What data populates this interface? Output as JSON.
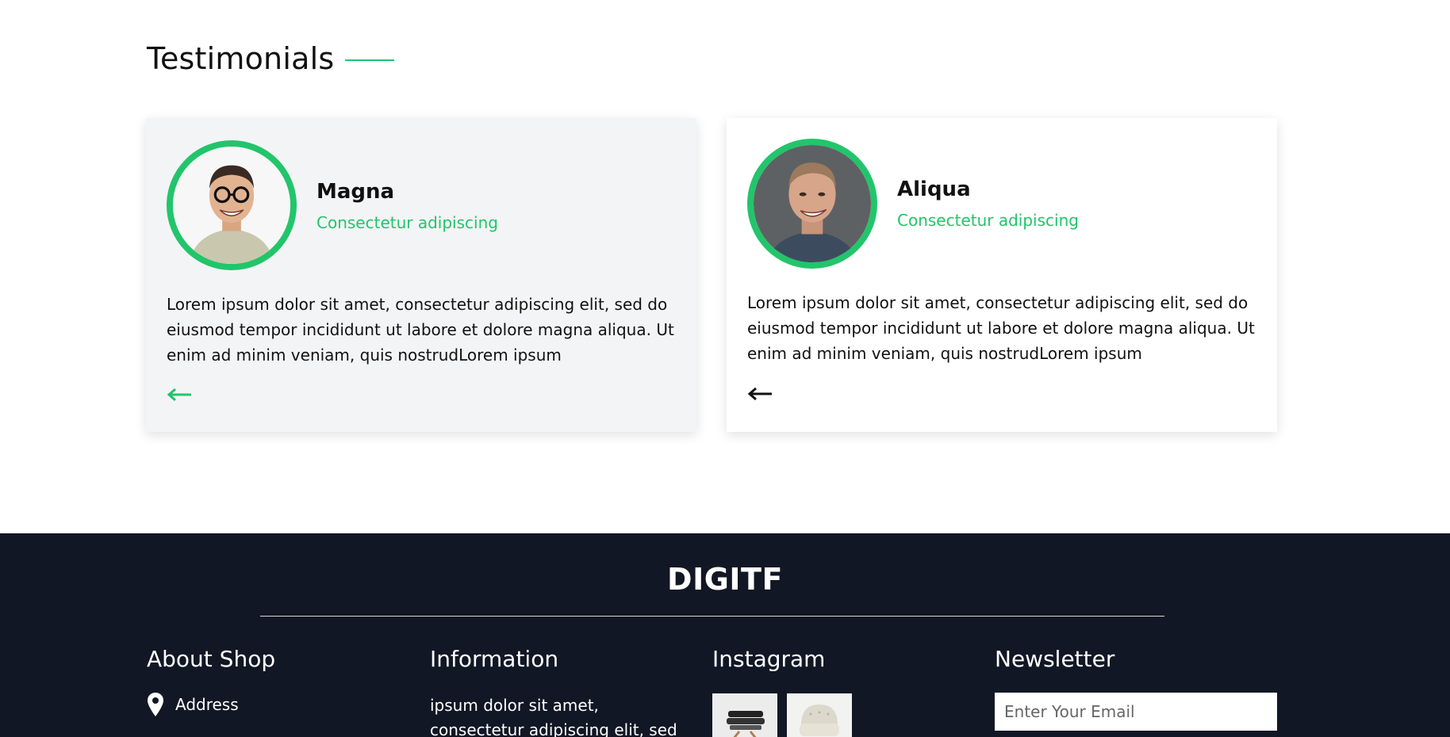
{
  "testimonials": {
    "title": "Testimonials",
    "items": [
      {
        "name": "Magna",
        "role": "Consectetur adipiscing",
        "quote": "Lorem ipsum dolor sit amet, consectetur adipiscing elit, sed do eiusmod tempor incididunt ut labore et dolore magna aliqua. Ut enim ad minim veniam, quis nostrudLorem ipsum",
        "arrow_color": "#22c56b"
      },
      {
        "name": "Aliqua",
        "role": "Consectetur adipiscing",
        "quote": "Lorem ipsum dolor sit amet, consectetur adipiscing elit, sed do eiusmod tempor incididunt ut labore et dolore magna aliqua. Ut enim ad minim veniam, quis nostrudLorem ipsum",
        "arrow_color": "#111111"
      }
    ]
  },
  "footer": {
    "brand": "DIGITF",
    "about": {
      "title": "About Shop",
      "address": "Address"
    },
    "information": {
      "title": "Information",
      "text": "ipsum dolor sit amet, consectetur adipiscing elit, sed do eiusmod"
    },
    "instagram": {
      "title": "Instagram"
    },
    "newsletter": {
      "title": "Newsletter",
      "placeholder": "Enter Your Email"
    }
  },
  "colors": {
    "accent": "#22c56b",
    "footer_bg": "#111724",
    "card_bg": "#f3f4f6"
  }
}
